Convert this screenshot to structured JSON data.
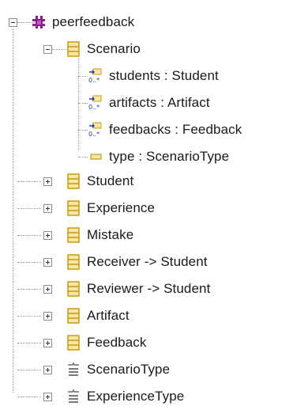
{
  "tree": {
    "root": {
      "label": "peerfeedback",
      "icon": "package-icon",
      "expanded": true
    },
    "scenario": {
      "label": "Scenario",
      "icon": "class-icon",
      "expanded": true,
      "children": [
        {
          "label": "students : Student",
          "icon": "reference-many-icon"
        },
        {
          "label": "artifacts : Artifact",
          "icon": "reference-many-icon"
        },
        {
          "label": "feedbacks : Feedback",
          "icon": "reference-many-icon"
        },
        {
          "label": "type : ScenarioType",
          "icon": "attribute-icon"
        }
      ]
    },
    "items": [
      {
        "label": "Student",
        "icon": "class-icon",
        "expanded": false
      },
      {
        "label": "Experience",
        "icon": "class-icon",
        "expanded": false
      },
      {
        "label": "Mistake",
        "icon": "class-icon",
        "expanded": false
      },
      {
        "label": "Receiver -> Student",
        "icon": "class-icon",
        "expanded": false
      },
      {
        "label": "Reviewer -> Student",
        "icon": "class-icon",
        "expanded": false
      },
      {
        "label": "Artifact",
        "icon": "class-icon",
        "expanded": false
      },
      {
        "label": "Feedback",
        "icon": "class-icon",
        "expanded": false
      },
      {
        "label": "ScenarioType",
        "icon": "enum-icon",
        "expanded": false
      },
      {
        "label": "ExperienceType",
        "icon": "enum-icon",
        "expanded": false
      }
    ],
    "colors": {
      "package": "#8a1f8a",
      "class_fill": "#f8e6a4",
      "class_border": "#c79a1a",
      "reference": "#1f3fa6",
      "enum": "#7a7a7a",
      "tree_line": "#9a9a9a"
    }
  }
}
